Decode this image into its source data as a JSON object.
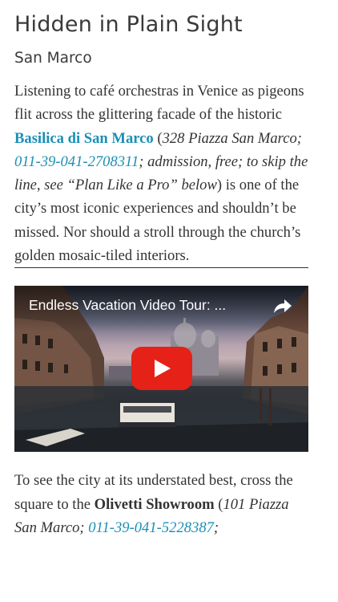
{
  "article": {
    "section_title": "Hidden in Plain Sight",
    "subheading": "San Marco",
    "para1": {
      "intro": "Listening to café orchestras in Venice as pigeons flit across the glittering facade of the historic ",
      "venue": "Basilica di San Marco",
      "open_paren": " (",
      "address": "328 Piazza San Marco; ",
      "phone": "011-39-041-2708311",
      "details": "; admission, free; to skip the line, see “Plan Like a Pro” below",
      "rest": ") is one of the city’s most iconic experiences and shouldn’t be missed. Nor should a stroll through the church’s golden mosaic-tiled interiors."
    },
    "para2": {
      "intro": "To see the city at its understated best, cross the square to the ",
      "venue": "Olivetti Showroom",
      "open_paren": " (",
      "address": "101 Piazza San Marco; ",
      "phone": "011-39-041-5228387",
      "tail": ";"
    }
  },
  "video": {
    "title": "Endless Vacation Video Tour: ...",
    "icons": {
      "share": "share-arrow-icon",
      "play": "play-icon"
    },
    "colors": {
      "play_button": "#e62117"
    }
  },
  "colors": {
    "link": "#1a8fb5",
    "text": "#333333"
  }
}
